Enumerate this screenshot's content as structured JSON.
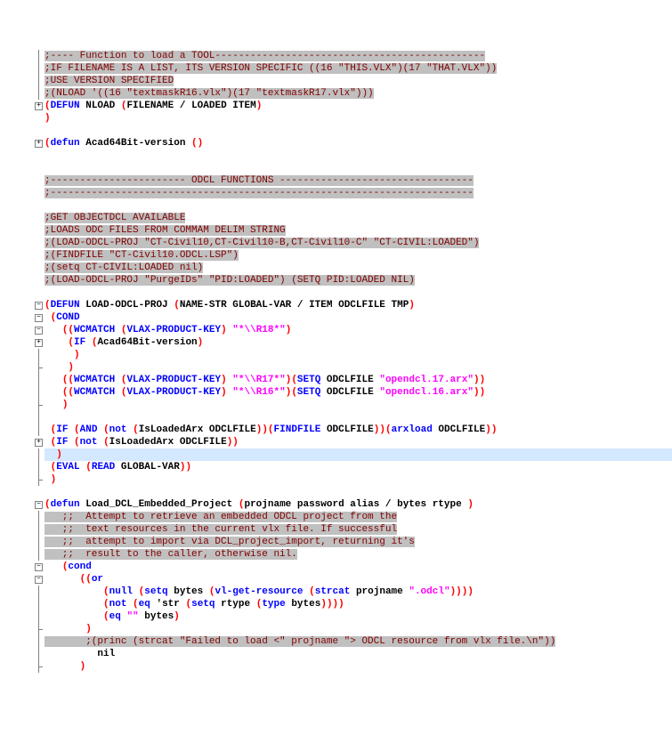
{
  "lines": [
    {
      "g": "|",
      "c": ";---- Function to load a TOOL----------------------------------------------",
      "cls": "hl-comment"
    },
    {
      "g": "|",
      "c": ";IF FILENAME IS A LIST, ITS VERSION SPECIFIC ((16 \"THIS.VLX\")(17 \"THAT.VLX\"))",
      "cls": "hl-comment"
    },
    {
      "g": "|",
      "c": ";USE VERSION SPECIFIED",
      "cls": "hl-comment"
    },
    {
      "g": "|",
      "c": ";(NLOAD '((16 \"textmaskR16.vlx\")(17 \"textmaskR17.vlx\")))",
      "cls": "hl-comment"
    },
    {
      "g": "[+]",
      "segs": [
        {
          "t": "(",
          "c": "paren"
        },
        {
          "t": "DEFUN",
          "c": "kw"
        },
        {
          "t": " NLOAD ",
          "c": "sym"
        },
        {
          "t": "(",
          "c": "paren"
        },
        {
          "t": "FILENAME / LOADED ITEM",
          "c": "sym"
        },
        {
          "t": ")",
          "c": "paren"
        }
      ]
    },
    {
      "g": "",
      "segs": [
        {
          "t": ")",
          "c": "paren"
        }
      ]
    },
    {
      "g": "",
      "c": ""
    },
    {
      "g": "[+]",
      "segs": [
        {
          "t": "(",
          "c": "paren"
        },
        {
          "t": "defun",
          "c": "kw"
        },
        {
          "t": " Acad64Bit-version ",
          "c": "sym"
        },
        {
          "t": "()",
          "c": "paren"
        }
      ]
    },
    {
      "g": "",
      "c": ""
    },
    {
      "g": "",
      "c": ""
    },
    {
      "g": "",
      "c": ";----------------------- ODCL FUNCTIONS ---------------------------------",
      "cls": "hl-comment"
    },
    {
      "g": "",
      "c": ";------------------------------------------------------------------------",
      "cls": "hl-comment"
    },
    {
      "g": "",
      "c": ""
    },
    {
      "g": "",
      "c": ";GET OBJECTDCL AVAILABLE",
      "cls": "hl-comment"
    },
    {
      "g": "",
      "c": ";LOADS ODC FILES FROM COMMAM DELIM STRING",
      "cls": "hl-comment"
    },
    {
      "g": "",
      "c": ";(LOAD-ODCL-PROJ \"CT-Civil10,CT-Civil10-B,CT-Civil10-C\" \"CT-CIVIL:LOADED\")",
      "cls": "hl-comment"
    },
    {
      "g": "",
      "c": ";(FINDFILE \"CT-Civil10.ODCL.LSP\")",
      "cls": "hl-comment"
    },
    {
      "g": "",
      "c": ";(setq CT-CIVIL:LOADED nil)",
      "cls": "hl-comment"
    },
    {
      "g": "",
      "c": ";(LOAD-ODCL-PROJ \"PurgeIDs\" \"PID:LOADED\") (SETQ PID:LOADED NIL)",
      "cls": "hl-comment"
    },
    {
      "g": "",
      "c": ""
    },
    {
      "g": "[-]",
      "segs": [
        {
          "t": "(",
          "c": "paren"
        },
        {
          "t": "DEFUN",
          "c": "kw"
        },
        {
          "t": " LOAD-ODCL-PROJ ",
          "c": "sym"
        },
        {
          "t": "(",
          "c": "paren"
        },
        {
          "t": "NAME-STR GLOBAL-VAR / ITEM ODCLFILE TMP",
          "c": "sym"
        },
        {
          "t": ")",
          "c": "paren"
        }
      ]
    },
    {
      "g": "[-]",
      "segs": [
        {
          "t": " ",
          "c": ""
        },
        {
          "t": "(",
          "c": "paren"
        },
        {
          "t": "COND",
          "c": "kw"
        }
      ]
    },
    {
      "g": "[-]",
      "segs": [
        {
          "t": "   ",
          "c": ""
        },
        {
          "t": "((",
          "c": "paren"
        },
        {
          "t": "WCMATCH",
          "c": "kw"
        },
        {
          "t": " ",
          "c": ""
        },
        {
          "t": "(",
          "c": "paren"
        },
        {
          "t": "VLAX-PRODUCT-KEY",
          "c": "kw"
        },
        {
          "t": ")",
          "c": "paren"
        },
        {
          "t": " ",
          "c": ""
        },
        {
          "t": "\"*\\\\R18*\"",
          "c": "str"
        },
        {
          "t": ")",
          "c": "paren"
        }
      ]
    },
    {
      "g": "[+]",
      "segs": [
        {
          "t": "    ",
          "c": ""
        },
        {
          "t": "(",
          "c": "paren"
        },
        {
          "t": "IF",
          "c": "kw"
        },
        {
          "t": " ",
          "c": ""
        },
        {
          "t": "(",
          "c": "paren"
        },
        {
          "t": "Acad64Bit-version",
          "c": "sym"
        },
        {
          "t": ")",
          "c": "paren"
        }
      ]
    },
    {
      "g": "|",
      "segs": [
        {
          "t": "     ",
          "c": ""
        },
        {
          "t": ")",
          "c": "paren"
        }
      ]
    },
    {
      "g": "L",
      "segs": [
        {
          "t": "    ",
          "c": ""
        },
        {
          "t": ")",
          "c": "paren"
        }
      ]
    },
    {
      "g": "|",
      "segs": [
        {
          "t": "   ",
          "c": ""
        },
        {
          "t": "((",
          "c": "paren"
        },
        {
          "t": "WCMATCH",
          "c": "kw"
        },
        {
          "t": " ",
          "c": ""
        },
        {
          "t": "(",
          "c": "paren"
        },
        {
          "t": "VLAX-PRODUCT-KEY",
          "c": "kw"
        },
        {
          "t": ")",
          "c": "paren"
        },
        {
          "t": " ",
          "c": ""
        },
        {
          "t": "\"*\\\\R17*\"",
          "c": "str"
        },
        {
          "t": ")(",
          "c": "paren"
        },
        {
          "t": "SETQ",
          "c": "kw"
        },
        {
          "t": " ODCLFILE ",
          "c": "sym"
        },
        {
          "t": "\"opendcl.17.arx\"",
          "c": "str"
        },
        {
          "t": "))",
          "c": "paren"
        }
      ]
    },
    {
      "g": "|",
      "segs": [
        {
          "t": "   ",
          "c": ""
        },
        {
          "t": "((",
          "c": "paren"
        },
        {
          "t": "WCMATCH",
          "c": "kw"
        },
        {
          "t": " ",
          "c": ""
        },
        {
          "t": "(",
          "c": "paren"
        },
        {
          "t": "VLAX-PRODUCT-KEY",
          "c": "kw"
        },
        {
          "t": ")",
          "c": "paren"
        },
        {
          "t": " ",
          "c": ""
        },
        {
          "t": "\"*\\\\R16*\"",
          "c": "str"
        },
        {
          "t": ")(",
          "c": "paren"
        },
        {
          "t": "SETQ",
          "c": "kw"
        },
        {
          "t": " ODCLFILE ",
          "c": "sym"
        },
        {
          "t": "\"opendcl.16.arx\"",
          "c": "str"
        },
        {
          "t": "))",
          "c": "paren"
        }
      ]
    },
    {
      "g": "L",
      "segs": [
        {
          "t": "   ",
          "c": ""
        },
        {
          "t": ")",
          "c": "paren"
        }
      ]
    },
    {
      "g": "|",
      "c": ""
    },
    {
      "g": "|",
      "segs": [
        {
          "t": " ",
          "c": ""
        },
        {
          "t": "(",
          "c": "paren"
        },
        {
          "t": "IF",
          "c": "kw"
        },
        {
          "t": " ",
          "c": ""
        },
        {
          "t": "(",
          "c": "paren"
        },
        {
          "t": "AND",
          "c": "kw"
        },
        {
          "t": " ",
          "c": ""
        },
        {
          "t": "(",
          "c": "paren"
        },
        {
          "t": "not",
          "c": "kw"
        },
        {
          "t": " ",
          "c": ""
        },
        {
          "t": "(",
          "c": "paren"
        },
        {
          "t": "IsLoadedArx ODCLFILE",
          "c": "sym"
        },
        {
          "t": "))(",
          "c": "paren"
        },
        {
          "t": "FINDFILE",
          "c": "kw"
        },
        {
          "t": " ODCLFILE",
          "c": "sym"
        },
        {
          "t": "))(",
          "c": "paren"
        },
        {
          "t": "arxload",
          "c": "kw"
        },
        {
          "t": " ODCLFILE",
          "c": "sym"
        },
        {
          "t": "))",
          "c": "paren"
        }
      ]
    },
    {
      "g": "[+]",
      "segs": [
        {
          "t": " ",
          "c": ""
        },
        {
          "t": "(",
          "c": "paren"
        },
        {
          "t": "IF",
          "c": "kw"
        },
        {
          "t": " ",
          "c": ""
        },
        {
          "t": "(",
          "c": "paren"
        },
        {
          "t": "not",
          "c": "kw"
        },
        {
          "t": " ",
          "c": ""
        },
        {
          "t": "(",
          "c": "paren"
        },
        {
          "t": "IsLoadedArx ODCLFILE",
          "c": "sym"
        },
        {
          "t": "))",
          "c": "paren"
        }
      ]
    },
    {
      "g": "|",
      "cur": true,
      "segs": [
        {
          "t": "  ",
          "c": ""
        },
        {
          "t": ")",
          "c": "paren"
        }
      ]
    },
    {
      "g": "|",
      "segs": [
        {
          "t": " ",
          "c": ""
        },
        {
          "t": "(",
          "c": "paren"
        },
        {
          "t": "EVAL",
          "c": "kw"
        },
        {
          "t": " ",
          "c": ""
        },
        {
          "t": "(",
          "c": "paren"
        },
        {
          "t": "READ",
          "c": "kw"
        },
        {
          "t": " GLOBAL-VAR",
          "c": "sym"
        },
        {
          "t": "))",
          "c": "paren"
        }
      ]
    },
    {
      "g": "L",
      "segs": [
        {
          "t": " ",
          "c": ""
        },
        {
          "t": ")",
          "c": "paren"
        }
      ]
    },
    {
      "g": "",
      "c": ""
    },
    {
      "g": "[-]",
      "segs": [
        {
          "t": "(",
          "c": "paren"
        },
        {
          "t": "defun",
          "c": "kw"
        },
        {
          "t": " Load_DCL_Embedded_Project ",
          "c": "sym"
        },
        {
          "t": "(",
          "c": "paren"
        },
        {
          "t": "projname password alias / bytes rtype ",
          "c": "sym"
        },
        {
          "t": ")",
          "c": "paren"
        }
      ]
    },
    {
      "g": "|",
      "c": "   ;;  Attempt to retrieve an embedded ODCL project from the",
      "cls": "hl-comment"
    },
    {
      "g": "|",
      "c": "   ;;  text resources in the current vlx file. If successful",
      "cls": "hl-comment"
    },
    {
      "g": "|",
      "c": "   ;;  attempt to import via DCL_project_import, returning it's",
      "cls": "hl-comment"
    },
    {
      "g": "|",
      "c": "   ;;  result to the caller, otherwise nil.",
      "cls": "hl-comment"
    },
    {
      "g": "[-]",
      "segs": [
        {
          "t": "   ",
          "c": ""
        },
        {
          "t": "(",
          "c": "paren"
        },
        {
          "t": "cond",
          "c": "kw"
        }
      ]
    },
    {
      "g": "[-]",
      "segs": [
        {
          "t": "      ",
          "c": ""
        },
        {
          "t": "((",
          "c": "paren"
        },
        {
          "t": "or",
          "c": "kw"
        }
      ]
    },
    {
      "g": "|",
      "segs": [
        {
          "t": "          ",
          "c": ""
        },
        {
          "t": "(",
          "c": "paren"
        },
        {
          "t": "null",
          "c": "kw"
        },
        {
          "t": " ",
          "c": ""
        },
        {
          "t": "(",
          "c": "paren"
        },
        {
          "t": "setq",
          "c": "kw"
        },
        {
          "t": " bytes ",
          "c": "sym"
        },
        {
          "t": "(",
          "c": "paren"
        },
        {
          "t": "vl-get-resource",
          "c": "kw"
        },
        {
          "t": " ",
          "c": ""
        },
        {
          "t": "(",
          "c": "paren"
        },
        {
          "t": "strcat",
          "c": "kw"
        },
        {
          "t": " projname ",
          "c": "sym"
        },
        {
          "t": "\".odcl\"",
          "c": "str"
        },
        {
          "t": "))))",
          "c": "paren"
        }
      ]
    },
    {
      "g": "|",
      "segs": [
        {
          "t": "          ",
          "c": ""
        },
        {
          "t": "(",
          "c": "paren"
        },
        {
          "t": "not",
          "c": "kw"
        },
        {
          "t": " ",
          "c": ""
        },
        {
          "t": "(",
          "c": "paren"
        },
        {
          "t": "eq",
          "c": "kw"
        },
        {
          "t": " ",
          "c": ""
        },
        {
          "t": "'str ",
          "c": "sym"
        },
        {
          "t": "(",
          "c": "paren"
        },
        {
          "t": "setq",
          "c": "kw"
        },
        {
          "t": " rtype ",
          "c": "sym"
        },
        {
          "t": "(",
          "c": "paren"
        },
        {
          "t": "type",
          "c": "kw"
        },
        {
          "t": " bytes",
          "c": "sym"
        },
        {
          "t": "))))",
          "c": "paren"
        }
      ]
    },
    {
      "g": "|",
      "segs": [
        {
          "t": "          ",
          "c": ""
        },
        {
          "t": "(",
          "c": "paren"
        },
        {
          "t": "eq",
          "c": "kw"
        },
        {
          "t": " ",
          "c": ""
        },
        {
          "t": "\"\"",
          "c": "str"
        },
        {
          "t": " bytes",
          "c": "sym"
        },
        {
          "t": ")",
          "c": "paren"
        }
      ]
    },
    {
      "g": "L",
      "segs": [
        {
          "t": "       ",
          "c": ""
        },
        {
          "t": ")",
          "c": "paren"
        }
      ]
    },
    {
      "g": "|",
      "c": "       ;(princ (strcat \"Failed to load <\" projname \"> ODCL resource from vlx file.\\n\"))",
      "cls": "hl-comment"
    },
    {
      "g": "|",
      "segs": [
        {
          "t": "         nil",
          "c": "sym"
        }
      ]
    },
    {
      "g": "L",
      "segs": [
        {
          "t": "      ",
          "c": ""
        },
        {
          "t": ")",
          "c": "paren"
        }
      ]
    }
  ]
}
